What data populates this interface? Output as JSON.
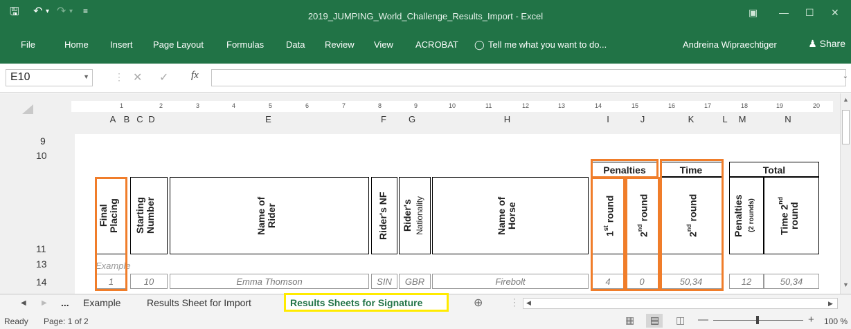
{
  "titlebar": {
    "save_icon": "save-icon",
    "undo_icon": "undo-icon",
    "title": "2019_JUMPING_World_Challenge_Results_Import - Excel"
  },
  "ribbon": {
    "tabs": [
      "File",
      "Home",
      "Insert",
      "Page Layout",
      "Formulas",
      "Data",
      "Review",
      "View",
      "ACROBAT"
    ],
    "tell_me": "Tell me what you want to do...",
    "user": "Andreina Wipraechtiger",
    "share": "Share"
  },
  "formula": {
    "namebox": "E10",
    "fx": "fx"
  },
  "ruler": [
    "1",
    "2",
    "3",
    "4",
    "5",
    "6",
    "7",
    "8",
    "9",
    "10",
    "11",
    "12",
    "13",
    "14",
    "15",
    "16",
    "17",
    "18",
    "19",
    "20"
  ],
  "columns": [
    "A",
    "B",
    "C",
    "D",
    "E",
    "F",
    "G",
    "H",
    "I",
    "J",
    "K",
    "L",
    "M",
    "N"
  ],
  "rows": [
    "9",
    "10",
    "11",
    "13",
    "14"
  ],
  "headers": {
    "penalties": "Penalties",
    "time": "Time",
    "total": "Total",
    "final_placing": "Final\nPlacing",
    "starting_number": "Starting\nNumber",
    "name_of_rider": "Name of\nRider",
    "riders_nf": "Rider's NF",
    "riders_nationality_a": "Rider's",
    "riders_nationality_b": "Nationality",
    "name_of_horse": "Name of\nHorse",
    "round1": "1",
    "round1_sup": "st",
    "round1_suffix": " round",
    "round2": "2",
    "round2_sup": "nd",
    "round2_suffix": " round",
    "time2": "2",
    "time2_sup": "nd",
    "time2_suffix": " round",
    "penalties_total": "Penalties",
    "penalties_total_sub": "(2 rounds)",
    "time_total_a": "Time 2",
    "time_total_sup": "nd",
    "time_total_b": "round"
  },
  "example": {
    "label": "Example",
    "placing": "1",
    "start_no": "10",
    "rider": "Emma Thomson",
    "nf": "SIN",
    "nationality": "GBR",
    "horse": "Firebolt",
    "pen1": "4",
    "pen2": "0",
    "time": "50,34",
    "pen_total": "12",
    "time_total": "50,34"
  },
  "sheet_tabs": {
    "more": "...",
    "tabs": [
      "Example",
      "Results Sheet for Import",
      "Results Sheets for Signature"
    ],
    "active": "Results Sheets for Signature"
  },
  "status": {
    "ready": "Ready",
    "page": "Page: 1 of 2",
    "zoom": "100 %"
  },
  "colors": {
    "excel_green": "#217346",
    "highlight_orange": "#f07d2a",
    "highlight_yellow": "#ffeb00"
  }
}
